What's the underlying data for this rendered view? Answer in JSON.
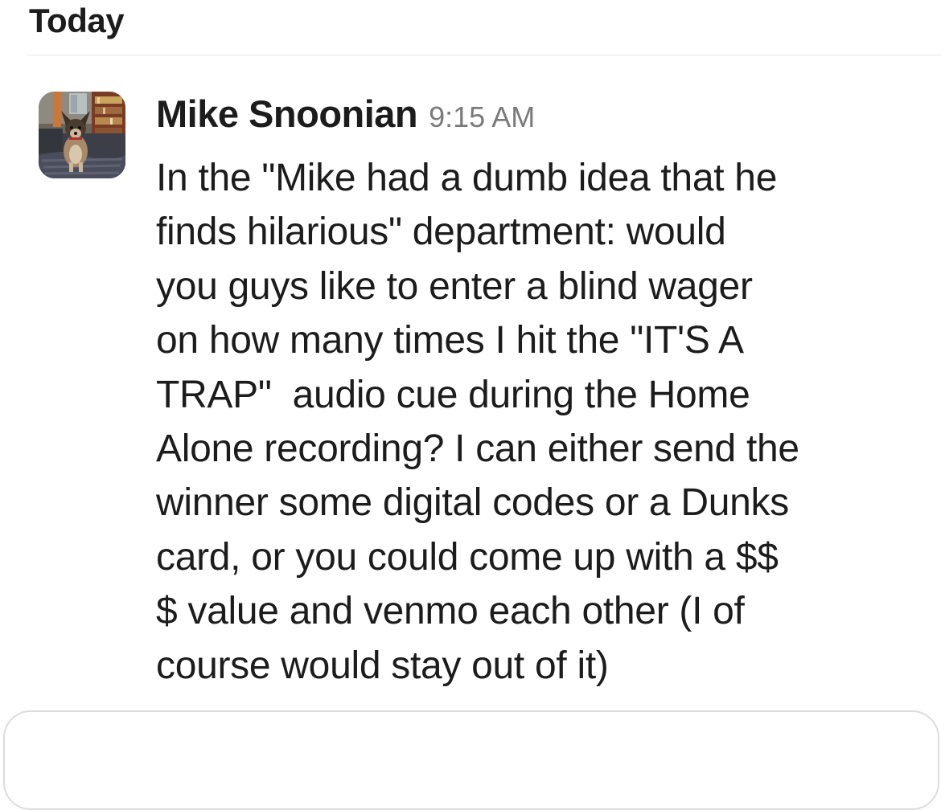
{
  "day_header": "Today",
  "message": {
    "author": "Mike Snoonian",
    "time": "9:15 AM",
    "lines": [
      "In the \"Mike had a dumb idea that he",
      "finds hilarious\" department: would",
      "you guys like to enter a blind wager",
      "on how many times I hit the \"IT'S A",
      "TRAP\"  audio cue during the Home",
      "Alone recording? I can either send the",
      "winner some digital codes or a Dunks",
      "card, or you could come up with a $$",
      "$ value and venmo each other (I of",
      "course would stay out of it)"
    ]
  },
  "icons": {
    "avatar": "dog-photo-avatar"
  }
}
